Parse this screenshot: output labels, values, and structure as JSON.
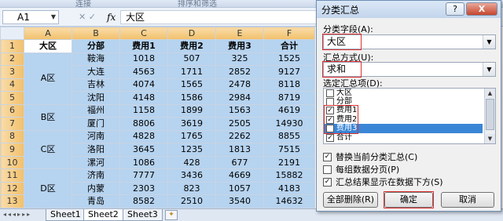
{
  "ribbon": {
    "left_text": "连接",
    "right_text": "排序和筛选"
  },
  "formula_bar": {
    "cell_ref": "A1",
    "fx_label": "fx",
    "tools": "✕ ✓",
    "content": "大区"
  },
  "grid": {
    "col_headers": [
      "A",
      "B",
      "C",
      "D",
      "E",
      "F"
    ],
    "row_numbers": [
      "1",
      "2",
      "3",
      "4",
      "5",
      "6",
      "7",
      "8",
      "9",
      "10",
      "11",
      "12",
      "13"
    ],
    "header_row": [
      "大区",
      "分部",
      "费用1",
      "费用2",
      "费用3",
      "合计"
    ],
    "rows": [
      [
        "",
        "鞍海",
        "1018",
        "507",
        "325",
        "1525"
      ],
      [
        "",
        "大连",
        "4563",
        "1711",
        "2852",
        "9127"
      ],
      [
        "",
        "吉林",
        "4074",
        "1565",
        "2478",
        "8118"
      ],
      [
        "",
        "沈阳",
        "4148",
        "1586",
        "2984",
        "8719"
      ],
      [
        "",
        "福州",
        "1158",
        "1899",
        "1563",
        "4619"
      ],
      [
        "",
        "厦门",
        "8806",
        "3619",
        "2505",
        "14930"
      ],
      [
        "",
        "河南",
        "4828",
        "1765",
        "2262",
        "8855"
      ],
      [
        "",
        "洛阳",
        "3645",
        "1235",
        "1813",
        "7515"
      ],
      [
        "",
        "漯河",
        "1086",
        "428",
        "677",
        "2191"
      ],
      [
        "",
        "济南",
        "7777",
        "3436",
        "4669",
        "15882"
      ],
      [
        "",
        "内蒙",
        "2303",
        "823",
        "1057",
        "4183"
      ],
      [
        "",
        "青岛",
        "8582",
        "2510",
        "3540",
        "14632"
      ]
    ],
    "regions": [
      "A区",
      "B区",
      "C区",
      "D区"
    ]
  },
  "sheet_tabs": {
    "nav": "◂◂◂▸▸▸",
    "tabs": [
      "Sheet1",
      "Sheet2",
      "Sheet3"
    ],
    "active": "Sheet2"
  },
  "dialog": {
    "title": "分类汇总",
    "help": "?",
    "close": "X",
    "group_field_label": "分类字段(A):",
    "group_field_value": "大区",
    "summary_func_label": "汇总方式(U):",
    "summary_func_value": "求和",
    "items_label": "选定汇总项(D):",
    "items": [
      {
        "label": "大区",
        "checked": false,
        "selected": false
      },
      {
        "label": "分部",
        "checked": false,
        "selected": false
      },
      {
        "label": "费用1",
        "checked": true,
        "selected": false
      },
      {
        "label": "费用2",
        "checked": true,
        "selected": false
      },
      {
        "label": "费用3",
        "checked": true,
        "selected": true
      },
      {
        "label": "合计",
        "checked": true,
        "selected": false
      }
    ],
    "options": [
      {
        "label": "替换当前分类汇总(C)",
        "checked": true
      },
      {
        "label": "每组数据分页(P)",
        "checked": false
      },
      {
        "label": "汇总结果显示在数据下方(S)",
        "checked": true
      }
    ],
    "btn_remove_all": "全部删除(R)",
    "btn_ok": "确定",
    "btn_cancel": "取消",
    "accent_red": "#e03030",
    "selection_blue": "#3a86d6"
  }
}
